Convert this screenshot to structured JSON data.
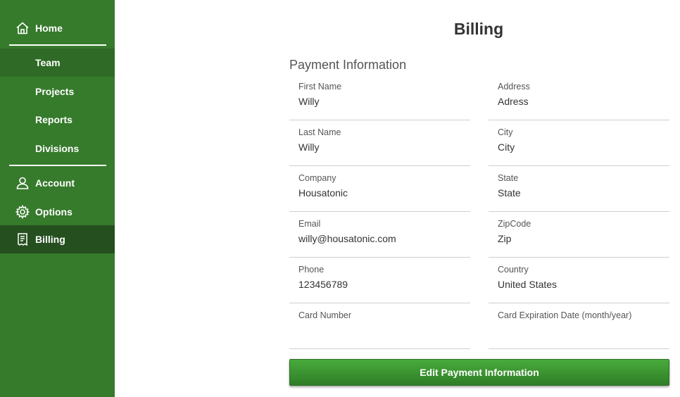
{
  "sidebar": {
    "home": "Home",
    "team": "Team",
    "projects": "Projects",
    "reports": "Reports",
    "divisions": "Divisions",
    "account": "Account",
    "options": "Options",
    "billing": "Billing"
  },
  "page": {
    "title": "Billing",
    "section_title": "Payment Information"
  },
  "form": {
    "left": [
      {
        "label": "First Name",
        "value": "Willy"
      },
      {
        "label": "Last Name",
        "value": "Willy"
      },
      {
        "label": "Company",
        "value": "Housatonic"
      },
      {
        "label": "Email",
        "value": "willy@housatonic.com"
      },
      {
        "label": "Phone",
        "value": "123456789"
      },
      {
        "label": "Card Number",
        "value": ""
      }
    ],
    "right": [
      {
        "label": "Address",
        "value": "Adress"
      },
      {
        "label": "City",
        "value": "City"
      },
      {
        "label": "State",
        "value": "State"
      },
      {
        "label": "ZipCode",
        "value": "Zip"
      },
      {
        "label": "Country",
        "value": "United States"
      },
      {
        "label": "Card Expiration Date (month/year)",
        "value": ""
      }
    ]
  },
  "actions": {
    "edit_label": "Edit Payment Information"
  },
  "colors": {
    "sidebar": "#367a2c",
    "active_item": "#254f1f",
    "button": "#3e9a33"
  },
  "icons": {
    "home": "home-icon",
    "account": "person-icon",
    "options": "gear-icon",
    "billing": "receipt-icon"
  }
}
